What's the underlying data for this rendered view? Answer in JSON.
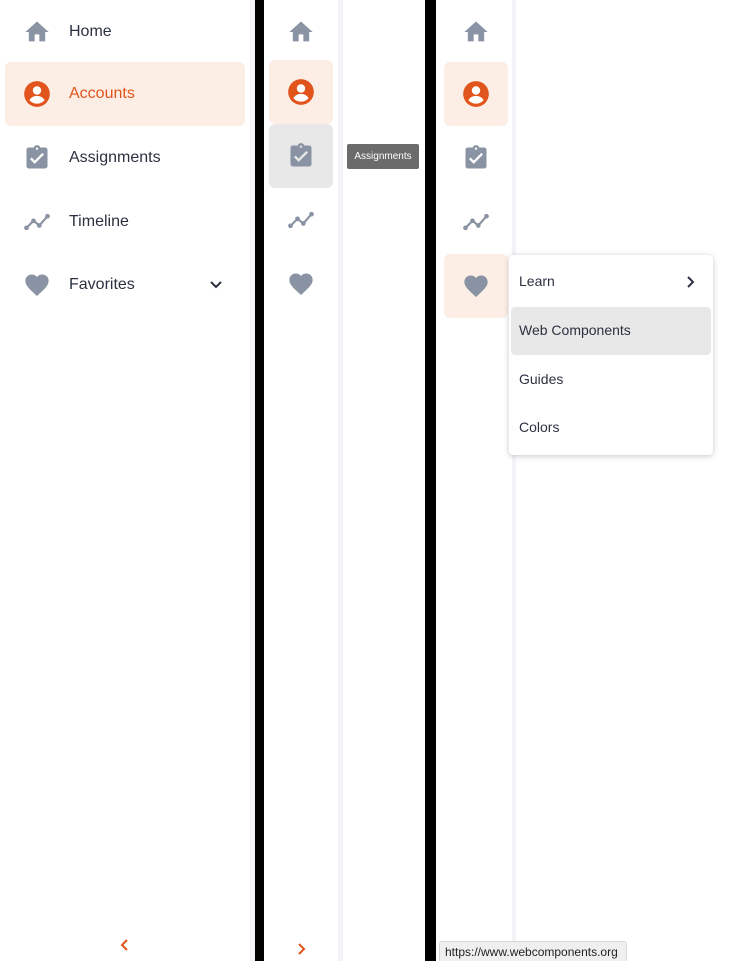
{
  "colors": {
    "accent": "#e1541b",
    "active_bg": "#fdeee5",
    "icon_gray": "#8a93a3",
    "text": "#2b3140",
    "hover_bg": "#e8e8e8",
    "tooltip_bg": "#6b6b6b"
  },
  "expanded_nav": {
    "items": [
      {
        "label": "Home",
        "icon": "home-icon"
      },
      {
        "label": "Accounts",
        "icon": "account-icon",
        "active": true
      },
      {
        "label": "Assignments",
        "icon": "assignment-icon"
      },
      {
        "label": "Timeline",
        "icon": "timeline-icon"
      },
      {
        "label": "Favorites",
        "icon": "heart-icon",
        "has_submenu": true
      }
    ],
    "collapse_icon": "chevron-left-icon"
  },
  "collapsed_rail": {
    "items": [
      "home-icon",
      "account-icon",
      "assignment-icon",
      "timeline-icon",
      "heart-icon"
    ],
    "active_index": 1,
    "hover_index": 2,
    "tooltip": "Assignments",
    "expand_icon": "chevron-right-icon"
  },
  "menu_rail": {
    "items": [
      "home-icon",
      "account-icon",
      "assignment-icon",
      "timeline-icon",
      "heart-icon"
    ],
    "active_index": 1,
    "open_index": 4,
    "menu": [
      {
        "label": "Learn",
        "has_submenu": true
      },
      {
        "label": "Web Components",
        "hover": true
      },
      {
        "label": "Guides"
      },
      {
        "label": "Colors"
      }
    ]
  },
  "status_url": "https://www.webcomponents.org"
}
